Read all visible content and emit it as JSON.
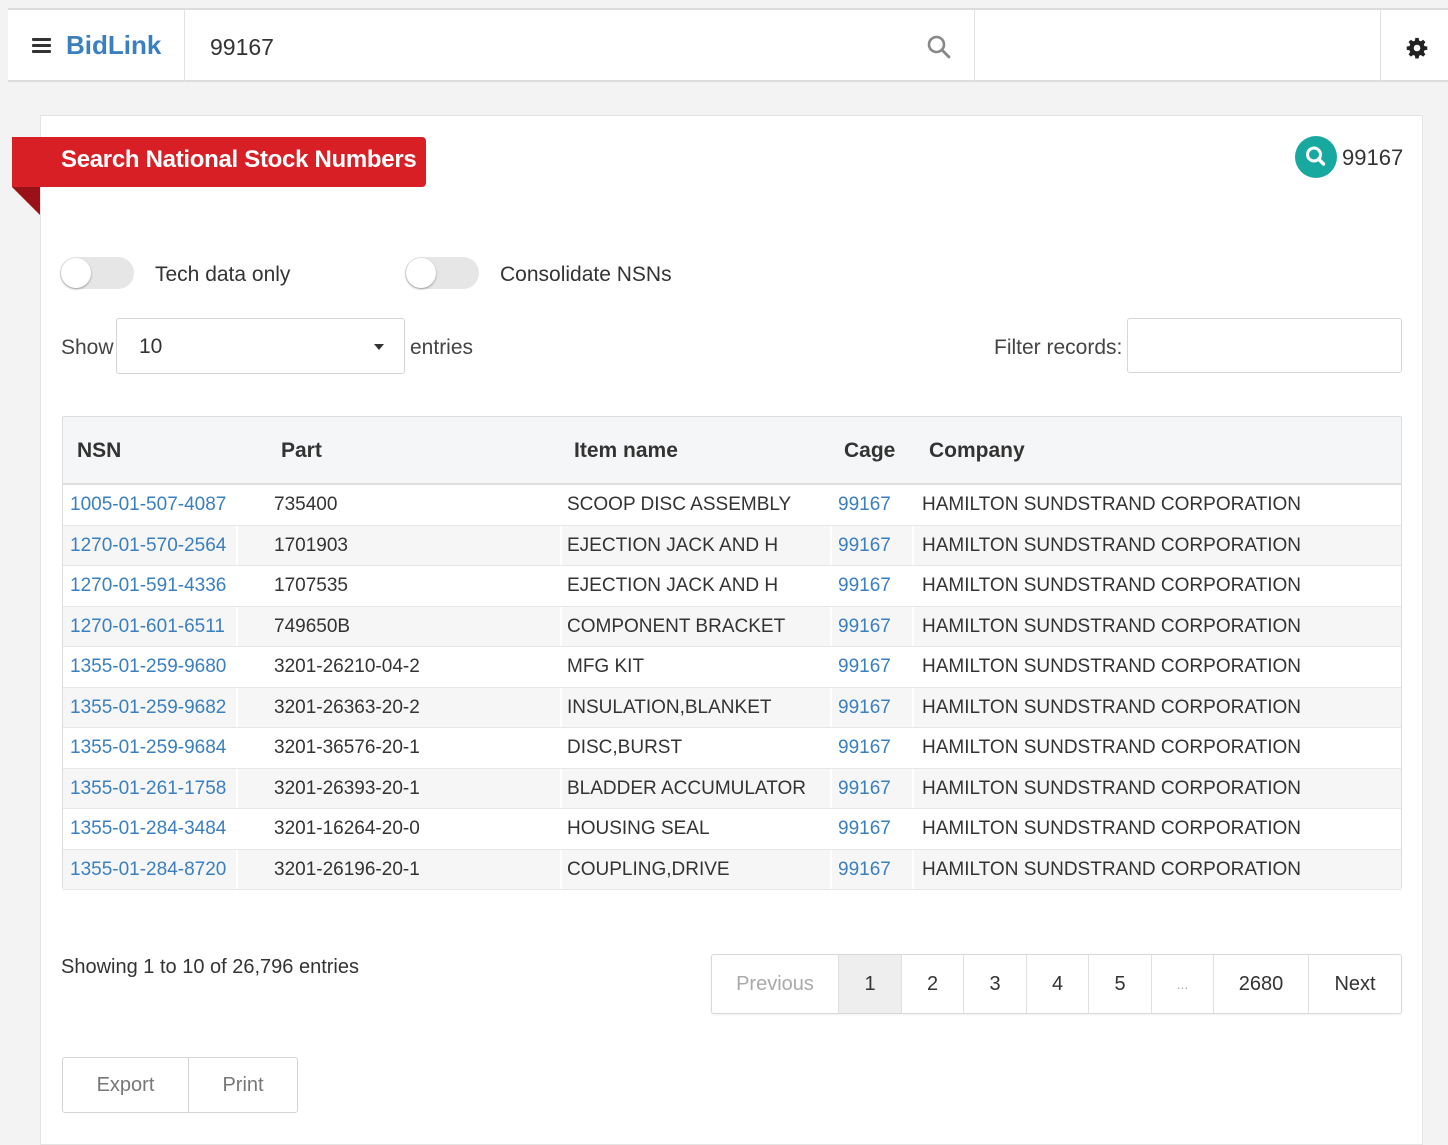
{
  "header": {
    "brand": "BidLink",
    "search_value": "99167",
    "icons": {
      "menu": "hamburger-icon",
      "search": "search-icon",
      "settings": "gear-icon"
    }
  },
  "card": {
    "title": "Search National Stock Numbers",
    "badge_text": "99167",
    "badge_icon": "search-icon",
    "colors": {
      "ribbon": "#d81f26",
      "badge": "#17a8a0",
      "link": "#3a7fc0"
    }
  },
  "toggles": [
    {
      "label": "Tech data only",
      "on": false
    },
    {
      "label": "Consolidate NSNs",
      "on": false
    }
  ],
  "entries": {
    "show_label": "Show",
    "selected": "10",
    "suffix_label": "entries",
    "filter_label": "Filter records:",
    "filter_value": ""
  },
  "table": {
    "columns": [
      "NSN",
      "Part",
      "Item name",
      "Cage",
      "Company"
    ],
    "rows": [
      [
        "1005-01-507-4087",
        "735400",
        "SCOOP DISC ASSEMBLY",
        "99167",
        "HAMILTON SUNDSTRAND CORPORATION"
      ],
      [
        "1270-01-570-2564",
        "1701903",
        "EJECTION JACK AND H",
        "99167",
        "HAMILTON SUNDSTRAND CORPORATION"
      ],
      [
        "1270-01-591-4336",
        "1707535",
        "EJECTION JACK AND H",
        "99167",
        "HAMILTON SUNDSTRAND CORPORATION"
      ],
      [
        "1270-01-601-6511",
        "749650B",
        "COMPONENT BRACKET",
        "99167",
        "HAMILTON SUNDSTRAND CORPORATION"
      ],
      [
        "1355-01-259-9680",
        "3201-26210-04-2",
        "MFG KIT",
        "99167",
        "HAMILTON SUNDSTRAND CORPORATION"
      ],
      [
        "1355-01-259-9682",
        "3201-26363-20-2",
        "INSULATION,BLANKET",
        "99167",
        "HAMILTON SUNDSTRAND CORPORATION"
      ],
      [
        "1355-01-259-9684",
        "3201-36576-20-1",
        "DISC,BURST",
        "99167",
        "HAMILTON SUNDSTRAND CORPORATION"
      ],
      [
        "1355-01-261-1758",
        "3201-26393-20-1",
        "BLADDER ACCUMULATOR",
        "99167",
        "HAMILTON SUNDSTRAND CORPORATION"
      ],
      [
        "1355-01-284-3484",
        "3201-16264-20-0",
        "HOUSING SEAL",
        "99167",
        "HAMILTON SUNDSTRAND CORPORATION"
      ],
      [
        "1355-01-284-8720",
        "3201-26196-20-1",
        "COUPLING,DRIVE",
        "99167",
        "HAMILTON SUNDSTRAND CORPORATION"
      ]
    ]
  },
  "footer": {
    "info": "Showing 1 to 10 of 26,796 entries",
    "pagination": [
      "Previous",
      "1",
      "2",
      "3",
      "4",
      "5",
      "...",
      "2680",
      "Next"
    ],
    "active_page": "1",
    "buttons": [
      "Export",
      "Print"
    ]
  }
}
